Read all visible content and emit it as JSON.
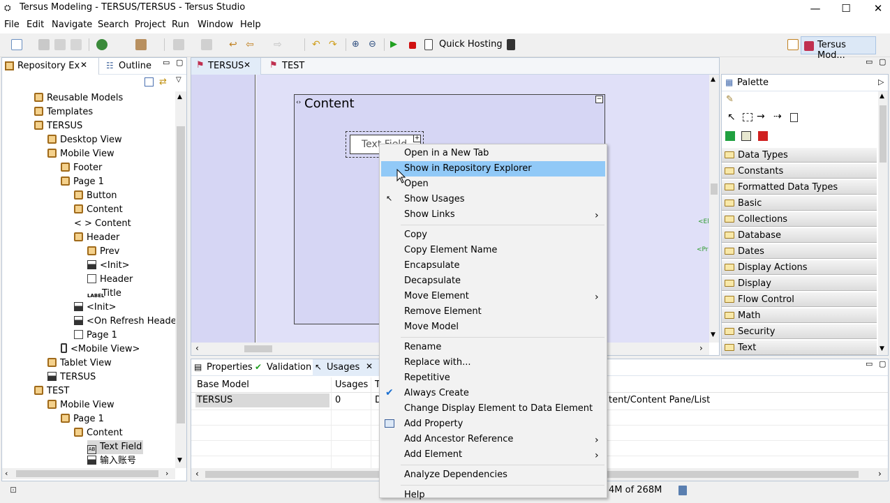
{
  "window": {
    "title": "Tersus Modeling - TERSUS/TERSUS - Tersus Studio",
    "min": "—",
    "max": "☐",
    "close": "✕"
  },
  "menu": [
    "File",
    "Edit",
    "Navigate",
    "Search",
    "Project",
    "Run",
    "Window",
    "Help"
  ],
  "toolbar": {
    "quick_hosting": "Quick Hosting",
    "perspective": "Tersus Mod..."
  },
  "repo": {
    "tab_label": "Repository Ex",
    "outline_label": "Outline",
    "items": [
      {
        "label": "Reusable Models",
        "depth": 0,
        "icon": "model"
      },
      {
        "label": "Templates",
        "depth": 0,
        "icon": "model"
      },
      {
        "label": "TERSUS",
        "depth": 0,
        "icon": "model"
      },
      {
        "label": "Desktop View",
        "depth": 1,
        "icon": "model"
      },
      {
        "label": "Mobile View",
        "depth": 1,
        "icon": "model"
      },
      {
        "label": "Footer",
        "depth": 2,
        "icon": "model"
      },
      {
        "label": "Page 1",
        "depth": 2,
        "icon": "model"
      },
      {
        "label": "Button",
        "depth": 3,
        "icon": "model"
      },
      {
        "label": "Content",
        "depth": 3,
        "icon": "model"
      },
      {
        "label": "< > Content",
        "depth": 3,
        "icon": "none"
      },
      {
        "label": "Header",
        "depth": 3,
        "icon": "model"
      },
      {
        "label": "Prev",
        "depth": 4,
        "icon": "model"
      },
      {
        "label": "<Init>",
        "depth": 4,
        "icon": "init"
      },
      {
        "label": "Header",
        "depth": 4,
        "icon": "display"
      },
      {
        "label": "Title",
        "depth": 4,
        "icon": "label"
      },
      {
        "label": "<Init>",
        "depth": 3,
        "icon": "init"
      },
      {
        "label": "<On Refresh Header>",
        "depth": 3,
        "icon": "init"
      },
      {
        "label": "Page 1",
        "depth": 3,
        "icon": "display"
      },
      {
        "label": "<Mobile View>",
        "depth": 2,
        "icon": "phone"
      },
      {
        "label": "Tablet View",
        "depth": 1,
        "icon": "model"
      },
      {
        "label": "TERSUS",
        "depth": 1,
        "icon": "init"
      },
      {
        "label": "TEST",
        "depth": 0,
        "icon": "model"
      },
      {
        "label": "Mobile View",
        "depth": 1,
        "icon": "model"
      },
      {
        "label": "Page 1",
        "depth": 2,
        "icon": "model"
      },
      {
        "label": "Content",
        "depth": 3,
        "icon": "model"
      },
      {
        "label": "Text Field",
        "depth": 4,
        "icon": "textfield"
      },
      {
        "label": "输入账号",
        "depth": 4,
        "icon": "init"
      }
    ]
  },
  "editor": {
    "tabs": [
      "TERSUS",
      "TEST"
    ],
    "content_title": "Content",
    "text_field": "Text Field",
    "side_label_1": "<El",
    "side_label_2": "<Pr"
  },
  "palette": {
    "title": "Palette",
    "groups": [
      "Data Types",
      "Constants",
      "Formatted Data Types",
      "Basic",
      "Collections",
      "Database",
      "Dates",
      "Display Actions",
      "Display",
      "Flow Control",
      "Math",
      "Security",
      "Text"
    ]
  },
  "bottom": {
    "tabs": [
      "Properties",
      "Validation",
      "Usages"
    ],
    "columns": [
      "Base Model",
      "Usages",
      "T"
    ],
    "row": {
      "base_model": "TERSUS",
      "usages": "0",
      "type": "D",
      "path": "tent/Content Pane/List"
    },
    "heap": "4M of 268M"
  },
  "context_menu": {
    "items": [
      {
        "label": "Open in a New Tab"
      },
      {
        "label": "Show in Repository Explorer",
        "highlight": true
      },
      {
        "label": "Open"
      },
      {
        "label": "Show Usages",
        "icon": "usages"
      },
      {
        "label": "Show Links",
        "submenu": true
      },
      {
        "sep": true
      },
      {
        "label": "Copy"
      },
      {
        "label": "Copy Element Name"
      },
      {
        "label": "Encapsulate"
      },
      {
        "label": "Decapsulate"
      },
      {
        "label": "Move Element",
        "submenu": true
      },
      {
        "label": "Remove Element"
      },
      {
        "label": "Move Model"
      },
      {
        "sep": true
      },
      {
        "label": "Rename"
      },
      {
        "label": "Replace with..."
      },
      {
        "label": "Repetitive"
      },
      {
        "label": "Always Create",
        "checked": true
      },
      {
        "label": "Change Display Element to Data Element"
      },
      {
        "label": "Add Property",
        "icon": "property"
      },
      {
        "label": "Add Ancestor Reference",
        "submenu": true
      },
      {
        "label": "Add Element",
        "submenu": true
      },
      {
        "sep": true
      },
      {
        "label": "Analyze Dependencies"
      },
      {
        "sep": true
      },
      {
        "label": "Help"
      }
    ]
  }
}
